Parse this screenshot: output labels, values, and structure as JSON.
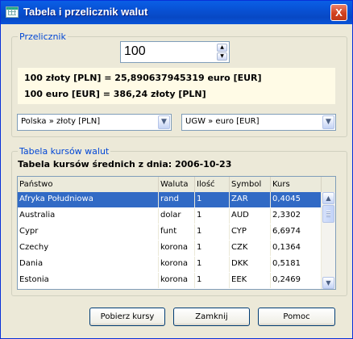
{
  "window": {
    "title": "Tabela i przelicznik walut",
    "close_symbol": "X"
  },
  "converter": {
    "group_label": "Przelicznik",
    "amount": "100",
    "result_line1": "100 złoty [PLN] = 25,890637945319 euro [EUR]",
    "result_line2": "100 euro [EUR] = 386,24 złoty [PLN]",
    "from_currency": "Polska » złoty [PLN]",
    "to_currency": "UGW » euro [EUR]"
  },
  "rates": {
    "group_label": "Tabela kursów walut",
    "table_title": "Tabela kursów średnich z dnia: 2006-10-23",
    "columns": [
      "Państwo",
      "Waluta",
      "Ilość",
      "Symbol",
      "Kurs"
    ],
    "rows": [
      [
        "Afryka Południowa",
        "rand",
        "1",
        "ZAR",
        "0,4045"
      ],
      [
        "Australia",
        "dolar",
        "1",
        "AUD",
        "2,3302"
      ],
      [
        "Cypr",
        "funt",
        "1",
        "CYP",
        "6,6974"
      ],
      [
        "Czechy",
        "korona",
        "1",
        "CZK",
        "0,1364"
      ],
      [
        "Dania",
        "korona",
        "1",
        "DKK",
        "0,5181"
      ],
      [
        "Estonia",
        "korona",
        "1",
        "EEK",
        "0,2469"
      ]
    ],
    "selected_row": 0
  },
  "buttons": {
    "fetch": "Pobierz kursy",
    "close": "Zamknij",
    "help": "Pomoc"
  },
  "colors": {
    "selection": "#316ac5",
    "titlebar": "#0851d4",
    "group_label": "#0046d5",
    "result_bg": "#fffbe6"
  }
}
